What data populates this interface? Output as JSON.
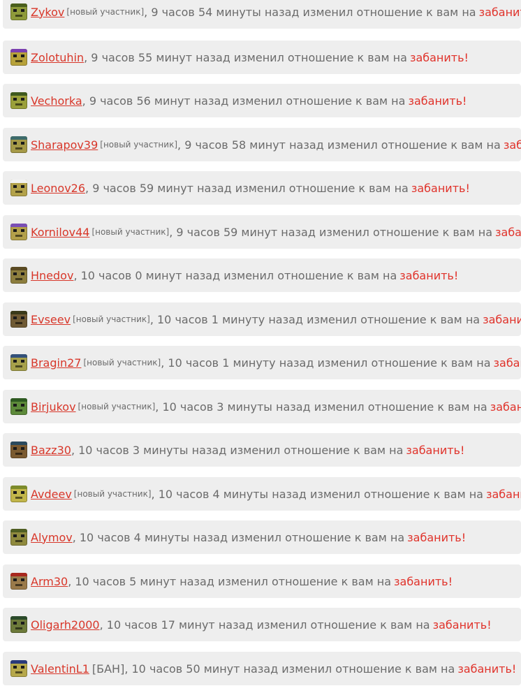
{
  "feed": {
    "action_label": "забанить!",
    "text_color": "#6b6b6b",
    "link_color": "#d8372a",
    "action_color": "#e0322a",
    "row_bg": "#eeeeee",
    "items": [
      {
        "user": "Zykov",
        "tag": "[новый участник]",
        "text": "9 часов 54 минуты назад изменил отношение к вам на",
        "avatar": {
          "face": "#8e9a3a",
          "hair": "#4a5e1c",
          "name": "avatar-zykov"
        }
      },
      {
        "user": "Zolotuhin",
        "tag": "",
        "text": "9 часов 55 минут назад изменил отношение к вам на",
        "avatar": {
          "face": "#b7a23a",
          "hair": "#7b3fb0",
          "name": "avatar-zolotuhin"
        }
      },
      {
        "user": "Vechorka",
        "tag": "",
        "text": "9 часов 56 минут назад изменил отношение к вам на",
        "avatar": {
          "face": "#9aa03a",
          "hair": "#3f5a1e",
          "name": "avatar-vechorka"
        }
      },
      {
        "user": "Sharapov39",
        "tag": "[новый участник]",
        "text": "9 часов 58 минут назад изменил отношение к вам на",
        "avatar": {
          "face": "#a69a48",
          "hair": "#3d6b6b",
          "name": "avatar-sharapov39"
        }
      },
      {
        "user": "Leonov26",
        "tag": "",
        "text": "9 часов 59 минут назад изменил отношение к вам на",
        "avatar": {
          "face": "#b3a24a",
          "hair": "#f2f2f2",
          "name": "avatar-leonov26"
        }
      },
      {
        "user": "Kornilov44",
        "tag": "[новый участник]",
        "text": "9 часов 59 минут назад изменил отношение к вам на",
        "avatar": {
          "face": "#b3a04a",
          "hair": "#7a4fb5",
          "name": "avatar-kornilov44"
        }
      },
      {
        "user": "Hnedov",
        "tag": "",
        "text": "10 часов 0 минут назад изменил отношение к вам на",
        "avatar": {
          "face": "#8d7e3e",
          "hair": "#5a4a22",
          "name": "avatar-hnedov"
        }
      },
      {
        "user": "Evseev",
        "tag": "[новый участник]",
        "text": "10 часов 1 минуту назад изменил отношение к вам на",
        "avatar": {
          "face": "#6f5a34",
          "hair": "#3a3a1a",
          "name": "avatar-evseev"
        }
      },
      {
        "user": "Bragin27",
        "tag": "[новый участник]",
        "text": "10 часов 1 минуту назад изменил отношение к вам на",
        "avatar": {
          "face": "#a6a04a",
          "hair": "#34517a",
          "name": "avatar-bragin27"
        }
      },
      {
        "user": "Birjukov",
        "tag": "[новый участник]",
        "text": "10 часов 3 минуты назад изменил отношение к вам на",
        "avatar": {
          "face": "#5d8a3a",
          "hair": "#2e5a22",
          "name": "avatar-birjukov"
        }
      },
      {
        "user": "Bazz30",
        "tag": "",
        "text": "10 часов 3 минуты назад изменил отношение к вам на",
        "avatar": {
          "face": "#7a5a30",
          "hair": "#2b4a5e",
          "name": "avatar-bazz30"
        }
      },
      {
        "user": "Avdeev",
        "tag": "[новый участник]",
        "text": "10 часов 4 минуты назад изменил отношение к вам на",
        "avatar": {
          "face": "#c2b64a",
          "hair": "#7c8a2a",
          "name": "avatar-avdeev"
        }
      },
      {
        "user": "Alymov",
        "tag": "",
        "text": "10 часов 4 минуты назад изменил отношение к вам на",
        "avatar": {
          "face": "#8f8a3e",
          "hair": "#4f5e22",
          "name": "avatar-alymov"
        }
      },
      {
        "user": "Arm30",
        "tag": "",
        "text": "10 часов 5 минут назад изменил отношение к вам на",
        "avatar": {
          "face": "#9a7a4a",
          "hair": "#a8281e",
          "name": "avatar-arm30"
        }
      },
      {
        "user": "Oligarh2000",
        "tag": "",
        "text": "10 часов 17 минут назад изменил отношение к вам на",
        "avatar": {
          "face": "#6d7a3a",
          "hair": "#2a4a2a",
          "name": "avatar-oligarh2000"
        }
      },
      {
        "user": "ValentinL1",
        "tag": "[БАН]",
        "text": "10 часов 50 минут назад изменил отношение к вам на",
        "avatar": {
          "face": "#b6a84a",
          "hair": "#2a3a7a",
          "name": "avatar-valentinl1"
        }
      }
    ]
  }
}
